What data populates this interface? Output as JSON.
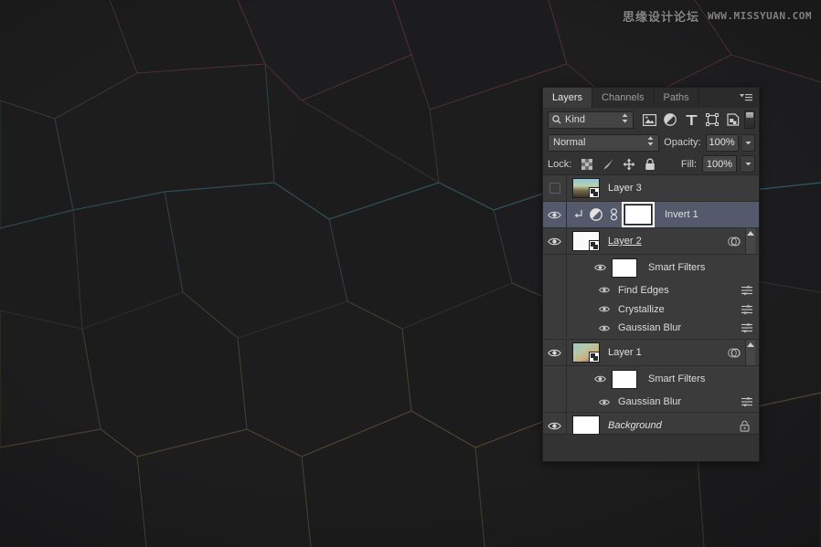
{
  "watermark": {
    "cn_text": "思缘设计论坛",
    "url_text": "WWW.MISSYUAN.COM"
  },
  "panel": {
    "tabs": [
      {
        "label": "Layers",
        "active": true
      },
      {
        "label": "Channels",
        "active": false
      },
      {
        "label": "Paths",
        "active": false
      }
    ],
    "menu_icon": "panel-menu-icon",
    "filter_bar": {
      "kind_label": "Kind",
      "search_icon": "search-icon",
      "icons": [
        "filter-pixel-layers-icon",
        "filter-adjustment-layers-icon",
        "filter-type-layers-icon",
        "filter-shape-layers-icon",
        "filter-smart-object-layers-icon"
      ],
      "toggle_name": "filter-enable-toggle"
    },
    "blend_row": {
      "blend_mode": "Normal",
      "opacity_label": "Opacity:",
      "opacity_value": "100%"
    },
    "lock_row": {
      "lock_label": "Lock:",
      "fill_label": "Fill:",
      "fill_value": "100%",
      "lock_icons": [
        "lock-transparent-pixels-icon",
        "lock-image-pixels-icon",
        "lock-position-icon",
        "lock-all-icon"
      ]
    },
    "layers": [
      {
        "id": "layer-3",
        "name": "Layer 3",
        "visible": false,
        "selected": false,
        "thumb_type": "photo-landscape",
        "smart_object": true,
        "underline": false,
        "italic": false,
        "locked": false
      },
      {
        "id": "invert-1",
        "name": "Invert 1",
        "visible": true,
        "selected": true,
        "thumb_type": "white-mask",
        "smart_object": false,
        "clipped": true,
        "adjustment_icon": "adjustment-invert-icon",
        "clip_icon": "clip-to-layer-icon",
        "link_icon": "link-mask-icon",
        "underline": false,
        "italic": false,
        "locked": false
      },
      {
        "id": "layer-2",
        "name": "Layer 2",
        "visible": true,
        "selected": false,
        "thumb_type": "white",
        "smart_object": true,
        "underline": true,
        "italic": false,
        "locked": false,
        "effects_icon": "smart-filter-badge-icon",
        "smart_filters": {
          "label": "Smart Filters",
          "visible": true,
          "mask_thumb": "white-mask",
          "filters": [
            {
              "name": "Find Edges",
              "visible": true,
              "options_icon": "filter-blending-options-icon"
            },
            {
              "name": "Crystallize",
              "visible": true,
              "options_icon": "filter-blending-options-icon"
            },
            {
              "name": "Gaussian Blur",
              "visible": true,
              "options_icon": "filter-blending-options-icon"
            }
          ]
        }
      },
      {
        "id": "layer-1",
        "name": "Layer 1",
        "visible": true,
        "selected": false,
        "thumb_type": "gradient-teal-tan",
        "smart_object": true,
        "underline": false,
        "italic": false,
        "locked": false,
        "effects_icon": "smart-filter-badge-icon",
        "smart_filters": {
          "label": "Smart Filters",
          "visible": true,
          "mask_thumb": "white-mask",
          "filters": [
            {
              "name": "Gaussian Blur",
              "visible": true,
              "options_icon": "filter-blending-options-icon"
            }
          ]
        }
      },
      {
        "id": "background",
        "name": "Background",
        "visible": true,
        "selected": false,
        "thumb_type": "white",
        "smart_object": false,
        "underline": false,
        "italic": true,
        "locked": true,
        "lock_icon": "lock-icon"
      }
    ]
  },
  "colors": {
    "panel_bg": "#333333",
    "list_bg": "#3b3b3b",
    "selected_row": "#54596b",
    "text": "#e0e0e0",
    "muted_text": "#9d9d9d",
    "canvas_bg": "#1b1b1b"
  }
}
